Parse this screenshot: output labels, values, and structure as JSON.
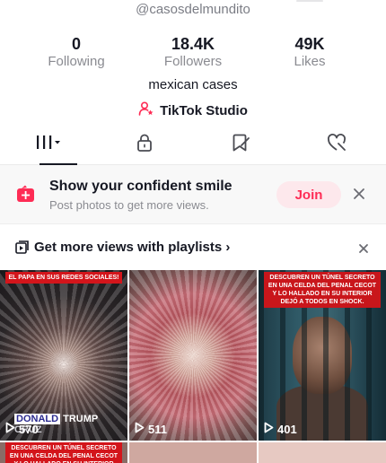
{
  "profile": {
    "handle": "@casosdelmundito",
    "bio": "mexican cases",
    "studio_label": "TikTok Studio"
  },
  "stats": [
    {
      "value": "0",
      "label": "Following"
    },
    {
      "value": "18.4K",
      "label": "Followers"
    },
    {
      "value": "49K",
      "label": "Likes"
    }
  ],
  "tabs": [
    {
      "icon": "videos-grid-icon",
      "active": true
    },
    {
      "icon": "lock-icon",
      "active": false
    },
    {
      "icon": "bookmark-icon",
      "active": false
    },
    {
      "icon": "liked-heart-icon",
      "active": false
    }
  ],
  "promo": {
    "title": "Show your confident smile",
    "subtitle": "Post photos to get more views.",
    "join_label": "Join"
  },
  "playlist": {
    "label": "Get more views with playlists",
    "chevron": "›"
  },
  "videos": [
    {
      "views": "570",
      "banner": "EL PAPA EN SUS REDES SOCIALES!",
      "caption_highlight": "DONALD",
      "caption_rest": "TRUMP",
      "caption_dim": "CRUZ"
    },
    {
      "views": "511"
    },
    {
      "views": "401",
      "banner": "DESCUBREN UN TÚNEL SECRETO EN UNA CELDA DEL PENAL CECOT Y LO HALLADO EN SU INTERIOR DEJÓ A TODOS EN SHOCK."
    },
    {
      "banner": "DESCUBREN UN TÚNEL SECRETO EN UNA CELDA DEL PENAL CECOT Y LO HALLADO EN SU INTERIOR DEJÓ A TODOS EN SHOCK."
    },
    {},
    {}
  ],
  "colors": {
    "accent": "#fe2c55",
    "join_bg": "#fde8ec",
    "text_primary": "#161823",
    "text_secondary": "#8a8b91"
  }
}
